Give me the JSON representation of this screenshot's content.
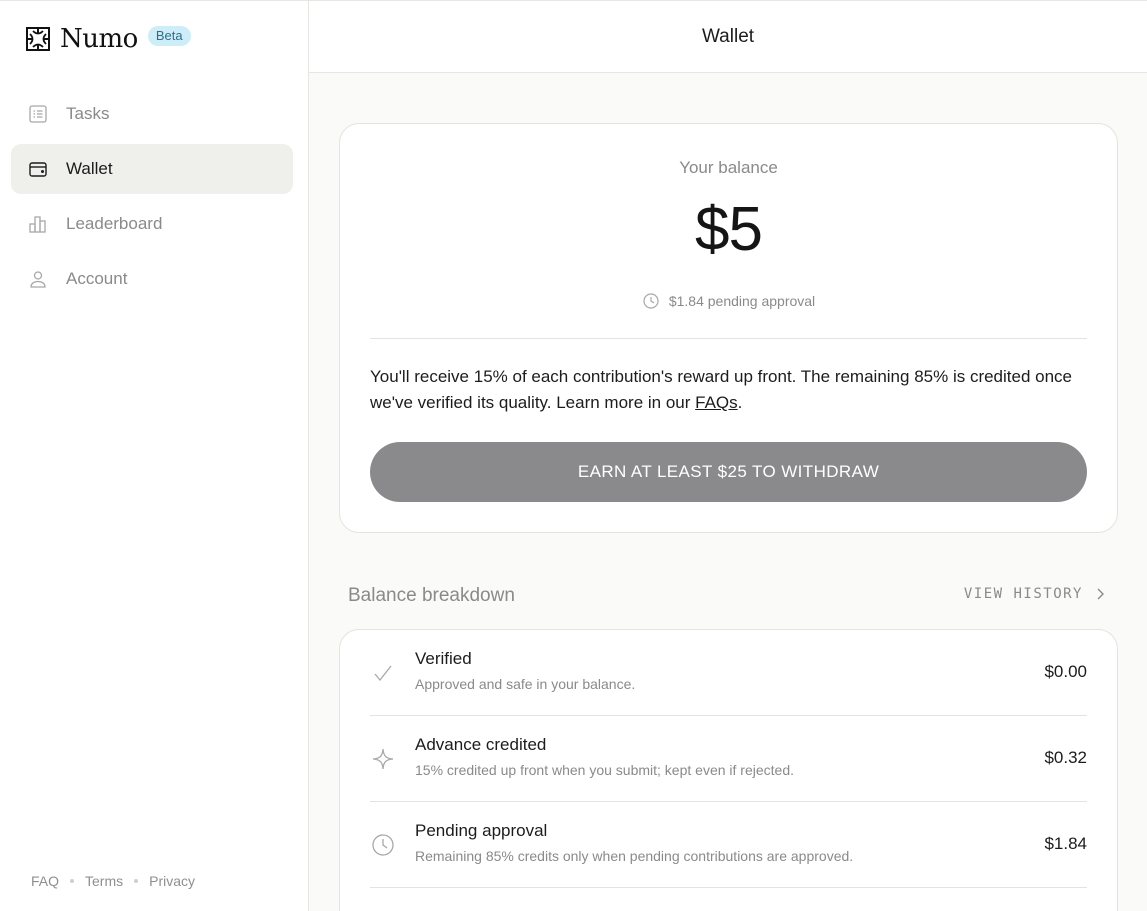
{
  "brand": {
    "name": "Numo",
    "badge": "Beta"
  },
  "nav": {
    "items": [
      {
        "label": "Tasks",
        "icon": "tasks-list-icon",
        "active": false
      },
      {
        "label": "Wallet",
        "icon": "wallet-icon",
        "active": true
      },
      {
        "label": "Leaderboard",
        "icon": "leaderboard-bars-icon",
        "active": false
      },
      {
        "label": "Account",
        "icon": "user-icon",
        "active": false
      }
    ]
  },
  "footer": {
    "faq": "FAQ",
    "terms": "Terms",
    "privacy": "Privacy"
  },
  "header": {
    "title": "Wallet"
  },
  "balance": {
    "label": "Your balance",
    "amount": "$5",
    "pending": "$1.84 pending approval",
    "info_text": "You'll receive 15% of each contribution's reward up front. The remaining 85% is credited once we've verified its quality. Learn more in our ",
    "info_link": "FAQs",
    "info_end": ".",
    "withdraw_label": "EARN AT LEAST $25 TO WITHDRAW"
  },
  "breakdown": {
    "title": "Balance breakdown",
    "view_history": "VIEW HISTORY",
    "rows": [
      {
        "title": "Verified",
        "desc": "Approved and safe in your balance.",
        "value": "$0.00",
        "icon": "check-icon"
      },
      {
        "title": "Advance credited",
        "desc": "15% credited up front when you submit; kept even if rejected.",
        "value": "$0.32",
        "icon": "sparkle-icon"
      },
      {
        "title": "Pending approval",
        "desc": "Remaining 85% credits only when pending contributions are approved.",
        "value": "$1.84",
        "icon": "clock-icon"
      }
    ]
  },
  "colors": {
    "accent_badge": "#cdeef8",
    "button_disabled": "#8a8a8c",
    "active_nav": "#efefeb"
  }
}
